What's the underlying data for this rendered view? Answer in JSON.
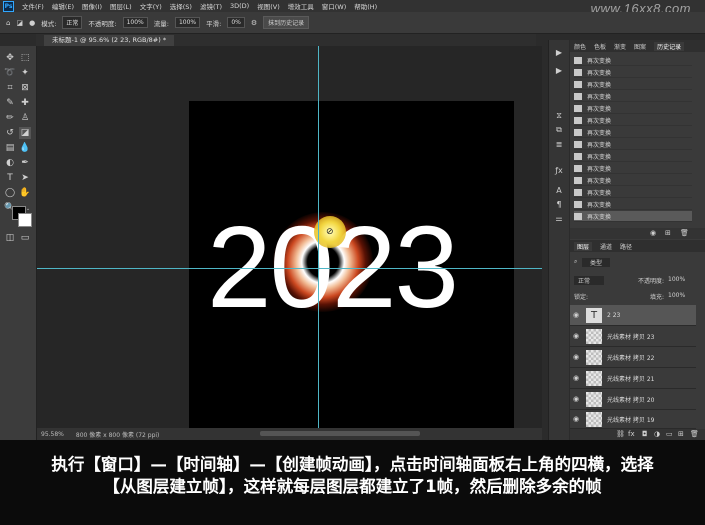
{
  "app": {
    "logo": "Ps",
    "menu": [
      "文件(F)",
      "编辑(E)",
      "图像(I)",
      "图层(L)",
      "文字(Y)",
      "选择(S)",
      "滤镜(T)",
      "3D(D)",
      "视图(V)",
      "增效工具",
      "窗口(W)",
      "帮助(H)"
    ],
    "watermark": "www.16xx8.com"
  },
  "options_bar": {
    "mode_label": "模式:",
    "mode_value": "正常",
    "opacity_label": "不透明度:",
    "opacity_value": "100%",
    "flow_label": "流量:",
    "flow_value": "100%",
    "smooth_label": "平滑:",
    "smooth_value": "0%",
    "history_button": "抹到历史记录"
  },
  "document": {
    "tab_label": "未标题-1 @ 95.6% (2 23, RGB/8#) *",
    "year_text": "2023"
  },
  "status": {
    "zoom": "95.58%",
    "size": "800 像素 x 800 像素 (72 ppi)"
  },
  "history_panel": {
    "tabs": [
      "颜色",
      "色板",
      "渐变",
      "图案",
      "历史记录"
    ],
    "item_label": "再次变换"
  },
  "layers_panel": {
    "tabs": [
      "图层",
      "通道",
      "路径"
    ],
    "kind_label": "类型",
    "blend_mode": "正常",
    "opacity_label": "不透明度:",
    "opacity_value": "100%",
    "lock_label": "锁定:",
    "fill_label": "填充:",
    "fill_value": "100%",
    "layers": [
      {
        "name": "2 23",
        "type": "text"
      },
      {
        "name": "光线素材 拷贝 23",
        "type": "image"
      },
      {
        "name": "光线素材 拷贝 22",
        "type": "image"
      },
      {
        "name": "光线素材 拷贝 21",
        "type": "image"
      },
      {
        "name": "光线素材 拷贝 20",
        "type": "image"
      },
      {
        "name": "光线素材 拷贝 19",
        "type": "image"
      }
    ]
  },
  "caption": {
    "line1": "执行【窗口】—【时间轴】—【创建帧动画】，点击时间轴面板右上角的四横，选择",
    "line2": "【从图层建立帧】，这样就每层图层都建立了1帧，然后删除多余的帧"
  }
}
